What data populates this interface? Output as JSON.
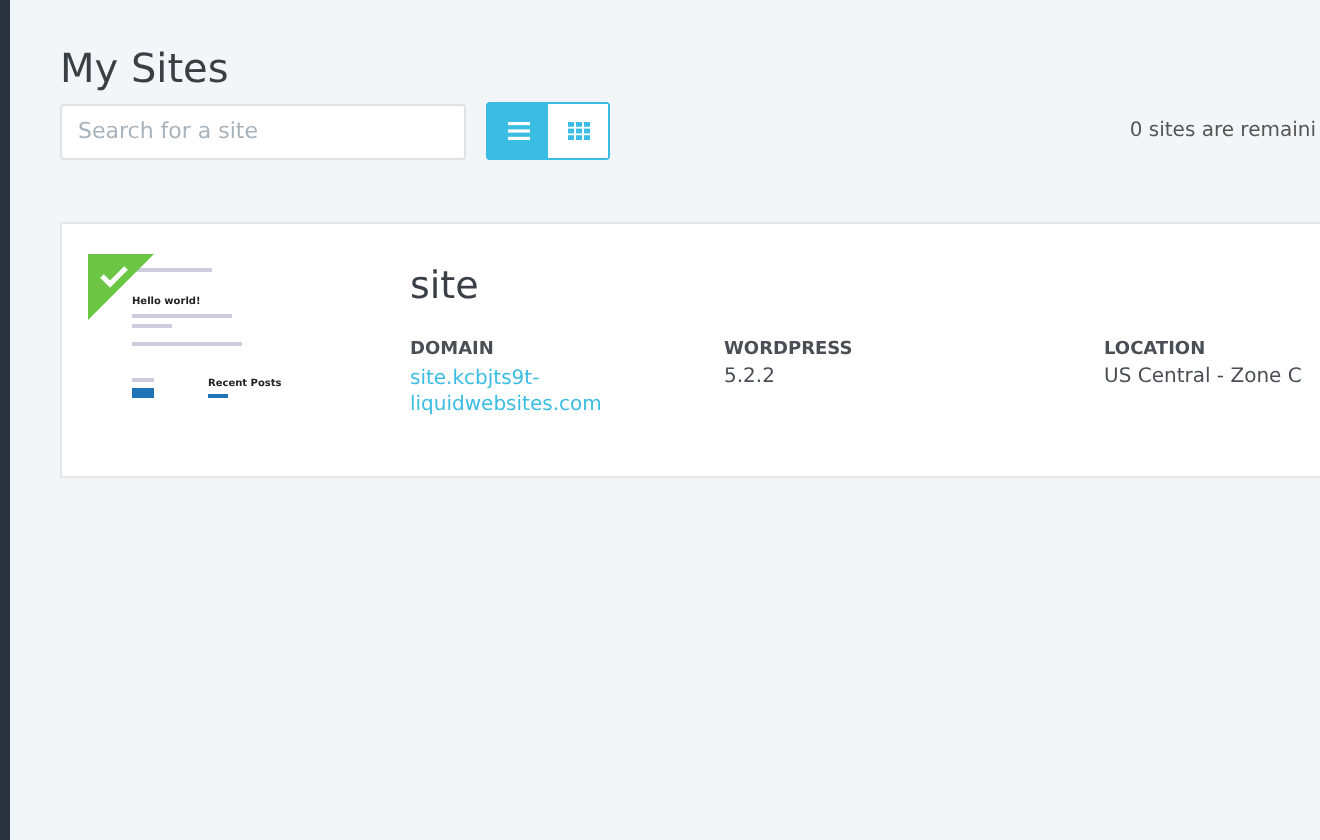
{
  "title": "My Sites",
  "search": {
    "placeholder": "Search for a site"
  },
  "view_toggle": [
    {
      "kind": "list",
      "selected": true
    },
    {
      "kind": "grid",
      "selected": false
    }
  ],
  "remaining": "0 sites are remaini",
  "sites": [
    {
      "name": "site",
      "verified": true,
      "thumbnail": {
        "heading": "Hello world!",
        "widget_title": "Recent Posts"
      },
      "fields": [
        {
          "label": "DOMAIN",
          "value": "site.kcbjts9t-liquidwebsites.com",
          "kind": "link"
        },
        {
          "label": "WORDPRESS",
          "value": "5.2.2",
          "kind": "text"
        },
        {
          "label": "LOCATION",
          "value": "US Central - Zone C",
          "kind": "text"
        }
      ]
    }
  ]
}
